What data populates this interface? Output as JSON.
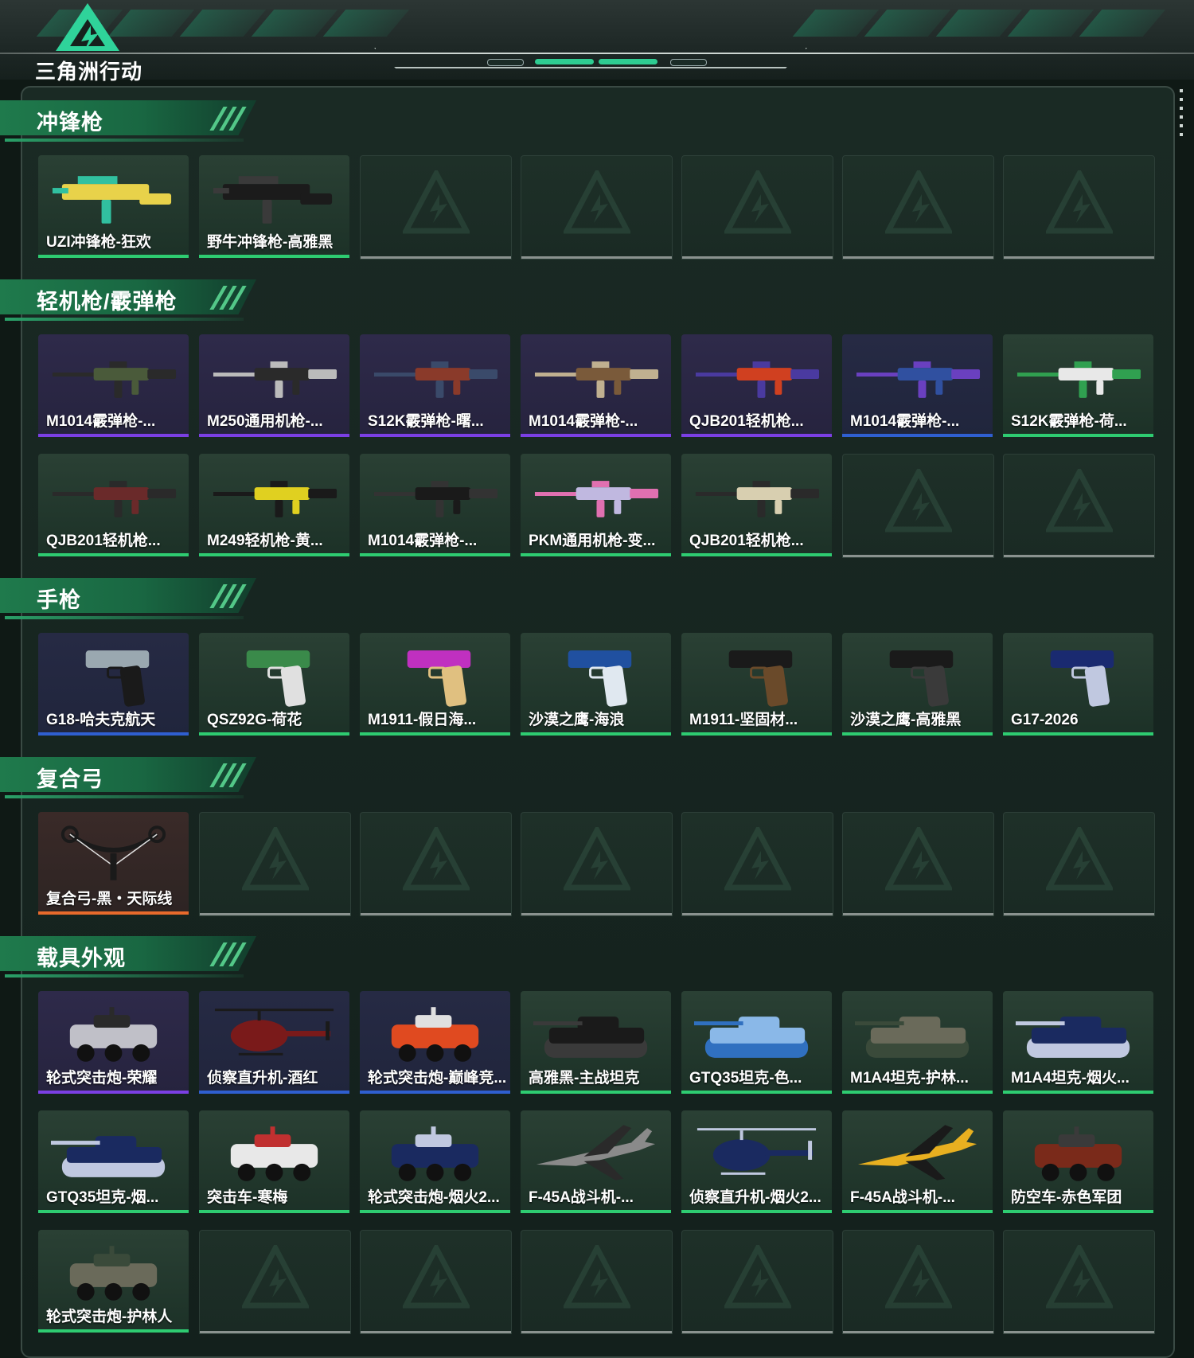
{
  "app": {
    "logo_text": "三角洲行动"
  },
  "colors": {
    "accent_green": "#2ecc71",
    "rarity_purple": "#7b3fe4",
    "rarity_blue": "#2f5fd0",
    "rarity_green": "#2ecc71",
    "rarity_orange": "#e86a2c",
    "empty_bar": "#8a928f"
  },
  "sections": [
    {
      "title": "冲锋枪",
      "slots": 7,
      "items": [
        {
          "label": "UZI冲锋枪-狂欢",
          "rarity": "green",
          "icon": "smg-icon",
          "tint": "#e8d24a",
          "tint2": "#31c0a0"
        },
        {
          "label": "野牛冲锋枪-高雅黑",
          "rarity": "green",
          "icon": "smg-icon",
          "tint": "#1b1b1b",
          "tint2": "#3a3a3a"
        }
      ]
    },
    {
      "title": "轻机枪/霰弹枪",
      "slots": 14,
      "items": [
        {
          "label": "M1014霰弹枪-...",
          "rarity": "purple",
          "icon": "rifle-icon",
          "tint": "#4a5a3a",
          "tint2": "#2a2a2a"
        },
        {
          "label": "M250通用机枪-...",
          "rarity": "purple",
          "icon": "rifle-icon",
          "tint": "#2a2a2a",
          "tint2": "#bbbbbb"
        },
        {
          "label": "S12K霰弹枪-曙...",
          "rarity": "purple",
          "icon": "rifle-icon",
          "tint": "#8a3a2a",
          "tint2": "#3a4a6a"
        },
        {
          "label": "M1014霰弹枪-...",
          "rarity": "purple",
          "icon": "rifle-icon",
          "tint": "#7a5a3a",
          "tint2": "#c0b090"
        },
        {
          "label": "QJB201轻机枪...",
          "rarity": "purple",
          "icon": "rifle-icon",
          "tint": "#d04020",
          "tint2": "#4a3aa0"
        },
        {
          "label": "M1014霰弹枪-...",
          "rarity": "blue",
          "icon": "rifle-icon",
          "tint": "#3050a0",
          "tint2": "#6a40c0"
        },
        {
          "label": "S12K霰弹枪-荷...",
          "rarity": "green",
          "icon": "rifle-icon",
          "tint": "#e8e8e8",
          "tint2": "#30a050"
        },
        {
          "label": "QJB201轻机枪...",
          "rarity": "green",
          "icon": "rifle-icon",
          "tint": "#6a2a2a",
          "tint2": "#2a2a2a"
        },
        {
          "label": "M249轻机枪-黄...",
          "rarity": "green",
          "icon": "rifle-icon",
          "tint": "#e0d020",
          "tint2": "#1a1a1a"
        },
        {
          "label": "M1014霰弹枪-...",
          "rarity": "green",
          "icon": "rifle-icon",
          "tint": "#1a1a1a",
          "tint2": "#333333"
        },
        {
          "label": "PKM通用机枪-变...",
          "rarity": "green",
          "icon": "rifle-icon",
          "tint": "#c0b8e0",
          "tint2": "#e070b0"
        },
        {
          "label": "QJB201轻机枪...",
          "rarity": "green",
          "icon": "rifle-icon",
          "tint": "#d8cfb0",
          "tint2": "#2a2a2a"
        }
      ]
    },
    {
      "title": "手枪",
      "slots": 7,
      "items": [
        {
          "label": "G18-哈夫克航天",
          "rarity": "blue",
          "icon": "pistol-icon",
          "tint": "#9aa8b0",
          "tint2": "#1a1a1a"
        },
        {
          "label": "QSZ92G-荷花",
          "rarity": "green",
          "icon": "pistol-icon",
          "tint": "#3a8a4a",
          "tint2": "#e0e0e0"
        },
        {
          "label": "M1911-假日海...",
          "rarity": "green",
          "icon": "pistol-icon",
          "tint": "#c030c0",
          "tint2": "#e0c080"
        },
        {
          "label": "沙漠之鹰-海浪",
          "rarity": "green",
          "icon": "pistol-icon",
          "tint": "#2050a0",
          "tint2": "#e0e8f0"
        },
        {
          "label": "M1911-坚固材...",
          "rarity": "green",
          "icon": "pistol-icon",
          "tint": "#1a1a1a",
          "tint2": "#6a4a2a"
        },
        {
          "label": "沙漠之鹰-高雅黑",
          "rarity": "green",
          "icon": "pistol-icon",
          "tint": "#1a1a1a",
          "tint2": "#3a3a3a"
        },
        {
          "label": "G17-2026",
          "rarity": "green",
          "icon": "pistol-icon",
          "tint": "#1a2a70",
          "tint2": "#c0c8e0"
        }
      ]
    },
    {
      "title": "复合弓",
      "slots": 7,
      "items": [
        {
          "label": "复合弓-黑・天际线",
          "rarity": "orange",
          "icon": "bow-icon",
          "tint": "#1a1a1a",
          "tint2": "#e0e0e0"
        }
      ]
    },
    {
      "title": "载具外观",
      "slots": 21,
      "items": [
        {
          "label": "轮式突击炮-荣耀",
          "rarity": "purple",
          "icon": "vehicle-icon",
          "tint": "#c0c0c8",
          "tint2": "#2a2a2a"
        },
        {
          "label": "侦察直升机-酒红",
          "rarity": "blue",
          "icon": "helicopter-icon",
          "tint": "#7a1a1a",
          "tint2": "#1a1a1a"
        },
        {
          "label": "轮式突击炮-巅峰竞...",
          "rarity": "blue",
          "icon": "vehicle-icon",
          "tint": "#e04a20",
          "tint2": "#e0e0e0"
        },
        {
          "label": "高雅黑-主战坦克",
          "rarity": "green",
          "icon": "tank-icon",
          "tint": "#1a1a1a",
          "tint2": "#3a3a3a"
        },
        {
          "label": "GTQ35坦克-色...",
          "rarity": "green",
          "icon": "tank-icon",
          "tint": "#8ab8e8",
          "tint2": "#3070c0"
        },
        {
          "label": "M1A4坦克-护林...",
          "rarity": "green",
          "icon": "tank-icon",
          "tint": "#6a6a5a",
          "tint2": "#3a4a3a"
        },
        {
          "label": "M1A4坦克-烟火...",
          "rarity": "green",
          "icon": "tank-icon",
          "tint": "#1a2a60",
          "tint2": "#c0c8e0"
        },
        {
          "label": "GTQ35坦克-烟...",
          "rarity": "green",
          "icon": "tank-icon",
          "tint": "#1a2a60",
          "tint2": "#c0c8e0"
        },
        {
          "label": "突击车-寒梅",
          "rarity": "green",
          "icon": "vehicle-icon",
          "tint": "#e8e8e8",
          "tint2": "#c03030"
        },
        {
          "label": "轮式突击炮-烟火2...",
          "rarity": "green",
          "icon": "vehicle-icon",
          "tint": "#1a2a60",
          "tint2": "#c0c8e0"
        },
        {
          "label": "F-45A战斗机-...",
          "rarity": "green",
          "icon": "jet-icon",
          "tint": "#8a8a8a",
          "tint2": "#2a2a2a"
        },
        {
          "label": "侦察直升机-烟火2...",
          "rarity": "green",
          "icon": "helicopter-icon",
          "tint": "#1a2a60",
          "tint2": "#c0c8e0"
        },
        {
          "label": "F-45A战斗机-...",
          "rarity": "green",
          "icon": "jet-icon",
          "tint": "#e8b020",
          "tint2": "#1a1a1a"
        },
        {
          "label": "防空车-赤色军团",
          "rarity": "green",
          "icon": "vehicle-icon",
          "tint": "#7a2a1a",
          "tint2": "#3a3a3a"
        },
        {
          "label": "轮式突击炮-护林人",
          "rarity": "green",
          "icon": "vehicle-icon",
          "tint": "#6a6a5a",
          "tint2": "#3a4a3a"
        }
      ]
    }
  ]
}
